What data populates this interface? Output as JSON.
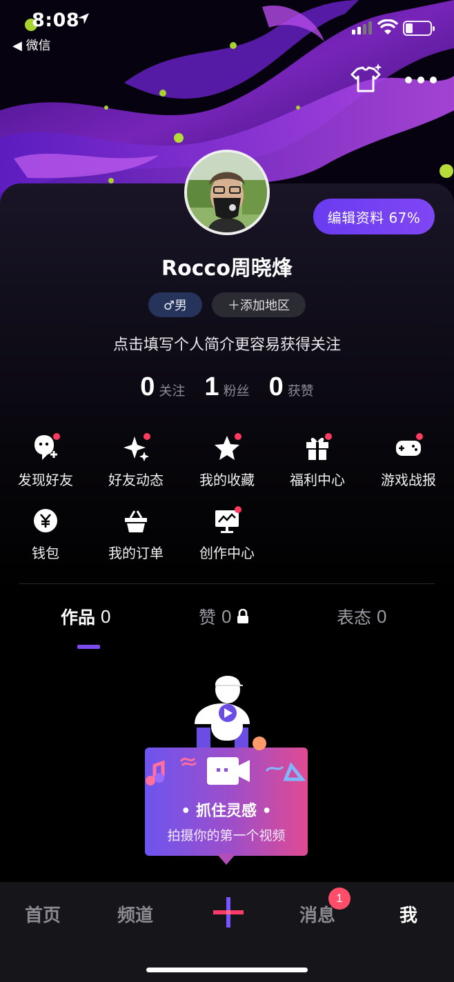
{
  "status_bar": {
    "time": "8:08",
    "back_app": "◀ 微信"
  },
  "profile": {
    "edit_label": "编辑资料 67%",
    "username": "Rocco周晓烽",
    "gender_tag": "♂男",
    "region_tag": "＋添加地区",
    "bio": "点击填写个人简介更容易获得关注"
  },
  "stats": [
    {
      "value": "0",
      "label": "关注"
    },
    {
      "value": "1",
      "label": "粉丝"
    },
    {
      "value": "0",
      "label": "获赞"
    }
  ],
  "shortcuts": [
    {
      "label": "发现好友",
      "icon": "find-friends-icon",
      "dot": true
    },
    {
      "label": "好友动态",
      "icon": "sparkle-icon",
      "dot": true
    },
    {
      "label": "我的收藏",
      "icon": "star-icon",
      "dot": true
    },
    {
      "label": "福利中心",
      "icon": "gift-icon",
      "dot": true
    },
    {
      "label": "游戏战报",
      "icon": "gamepad-icon",
      "dot": true
    },
    {
      "label": "钱包",
      "icon": "wallet-icon",
      "dot": false
    },
    {
      "label": "我的订单",
      "icon": "basket-icon",
      "dot": false
    },
    {
      "label": "创作中心",
      "icon": "creator-icon",
      "dot": true
    }
  ],
  "tabs": [
    {
      "label": "作品",
      "count": "0"
    },
    {
      "label": "赞",
      "count": "0"
    },
    {
      "label": "表态",
      "count": "0"
    }
  ],
  "empty_state": {
    "title": "• 抓住灵感 •",
    "subtitle": "拍摄你的第一个视频"
  },
  "bottom_nav": {
    "items": [
      "首页",
      "频道",
      "消息",
      "我"
    ],
    "message_badge": "1",
    "accent_colors": [
      "#ff3b6b",
      "#5b6cff"
    ]
  },
  "colors": {
    "accent": "#7b4bf0",
    "badge": "#ff4d6a"
  }
}
